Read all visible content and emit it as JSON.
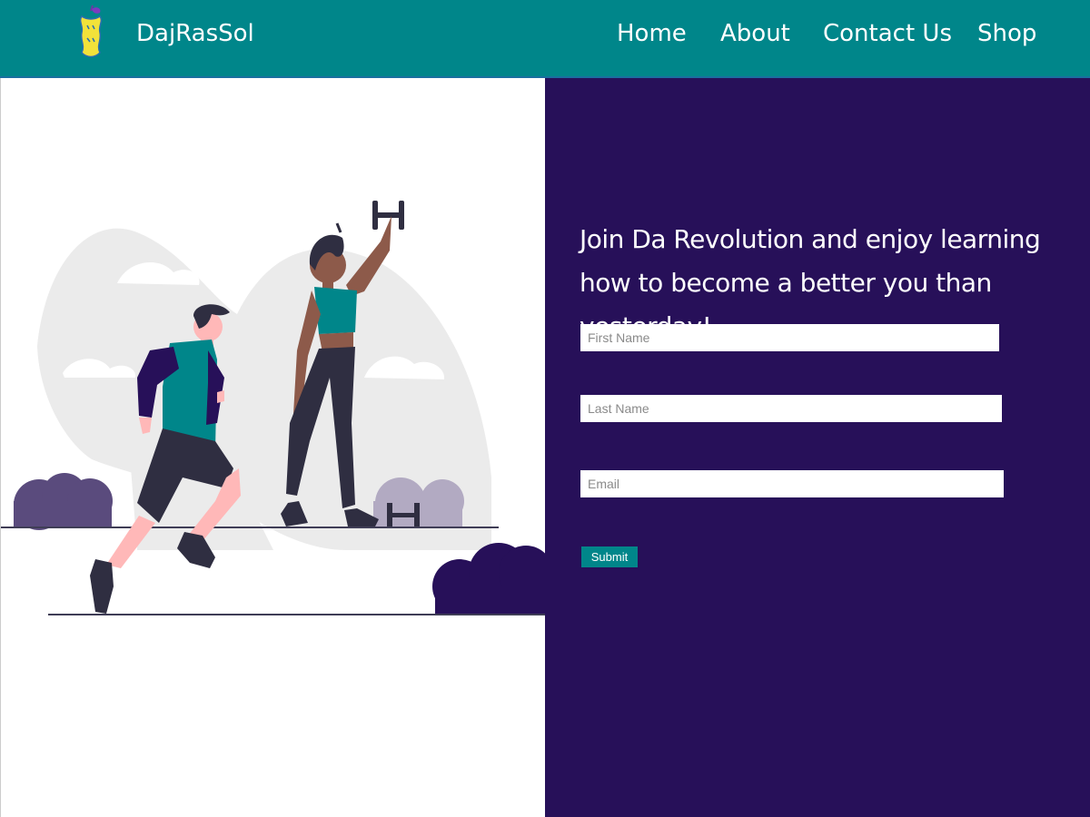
{
  "header": {
    "brand": "DajRasSol",
    "logo_icon": "apple-core-icon",
    "nav": [
      {
        "label": "Home"
      },
      {
        "label": "About"
      },
      {
        "label": "Contact Us"
      },
      {
        "label": "Shop"
      }
    ]
  },
  "hero": {
    "illustration": "workout-people-illustration"
  },
  "signup": {
    "headline": "Join Da Revolution and enjoy learning how to become a better you than yesterday!",
    "first_name_placeholder": "First Name",
    "last_name_placeholder": "Last Name",
    "email_placeholder": "Email",
    "submit_label": "Submit"
  },
  "colors": {
    "header_bg": "#00868a",
    "form_panel_bg": "#271059",
    "accent": "#00868a"
  }
}
